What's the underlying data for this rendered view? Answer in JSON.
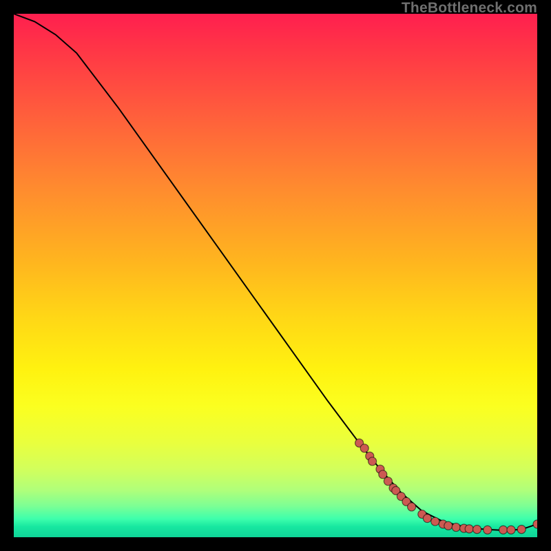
{
  "watermark": "TheBottleneck.com",
  "colors": {
    "marker_fill": "#cc5a52",
    "curve_stroke": "#000000"
  },
  "chart_data": {
    "type": "line",
    "title": "",
    "xlabel": "",
    "ylabel": "",
    "xlim": [
      0,
      100
    ],
    "ylim": [
      0,
      100
    ],
    "grid": false,
    "legend": false,
    "series": [
      {
        "name": "curve",
        "x": [
          0,
          4,
          8,
          12,
          20,
          30,
          40,
          50,
          60,
          66,
          70,
          74,
          78,
          82,
          86,
          90,
          94,
          97,
          100
        ],
        "y": [
          100,
          98.5,
          96,
          92.5,
          82,
          68,
          54,
          40,
          26,
          18,
          13,
          8.5,
          5,
          3,
          2,
          1.5,
          1.3,
          1.5,
          2.5
        ]
      }
    ],
    "markers": [
      {
        "x": 66,
        "y": 18
      },
      {
        "x": 67,
        "y": 17
      },
      {
        "x": 68,
        "y": 15.5
      },
      {
        "x": 68.5,
        "y": 14.5
      },
      {
        "x": 70,
        "y": 13
      },
      {
        "x": 70.5,
        "y": 12
      },
      {
        "x": 71.5,
        "y": 10.7
      },
      {
        "x": 72.5,
        "y": 9.4
      },
      {
        "x": 73,
        "y": 8.9
      },
      {
        "x": 74,
        "y": 7.8
      },
      {
        "x": 75,
        "y": 6.8
      },
      {
        "x": 76,
        "y": 5.8
      },
      {
        "x": 78,
        "y": 4.4
      },
      {
        "x": 79,
        "y": 3.6
      },
      {
        "x": 80.5,
        "y": 3.0
      },
      {
        "x": 82,
        "y": 2.5
      },
      {
        "x": 83,
        "y": 2.2
      },
      {
        "x": 84.5,
        "y": 1.9
      },
      {
        "x": 86,
        "y": 1.7
      },
      {
        "x": 87,
        "y": 1.6
      },
      {
        "x": 88.5,
        "y": 1.5
      },
      {
        "x": 90.5,
        "y": 1.4
      },
      {
        "x": 93.5,
        "y": 1.4
      },
      {
        "x": 95,
        "y": 1.4
      },
      {
        "x": 97,
        "y": 1.5
      },
      {
        "x": 100,
        "y": 2.5
      }
    ]
  }
}
